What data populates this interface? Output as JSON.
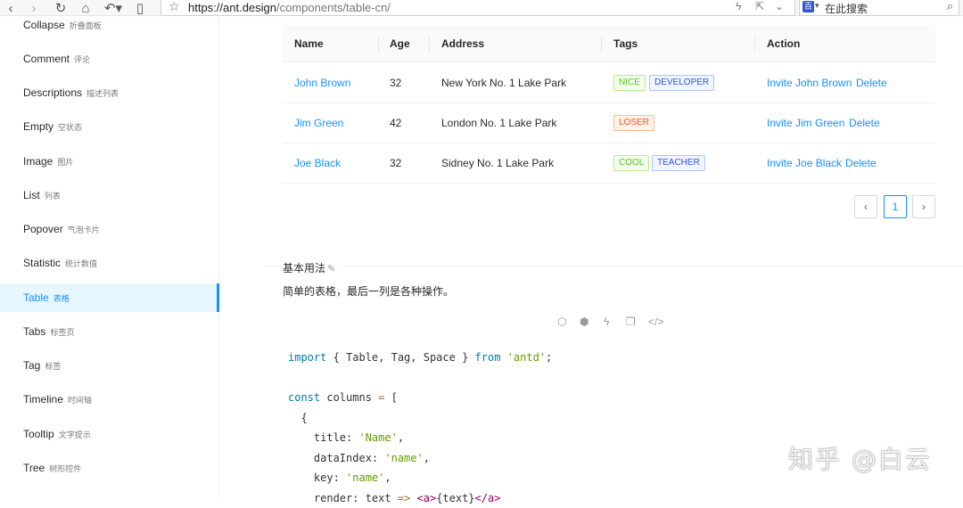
{
  "browser": {
    "url_host": "https://ant.design",
    "url_path": "/components/table-cn/",
    "search_placeholder": "在此搜索",
    "search_engine_label": "百"
  },
  "sidebar": {
    "items": [
      {
        "label": "Collapse",
        "cn": "折叠面板"
      },
      {
        "label": "Comment",
        "cn": "评论"
      },
      {
        "label": "Descriptions",
        "cn": "描述列表"
      },
      {
        "label": "Empty",
        "cn": "空状态"
      },
      {
        "label": "Image",
        "cn": "图片"
      },
      {
        "label": "List",
        "cn": "列表"
      },
      {
        "label": "Popover",
        "cn": "气泡卡片"
      },
      {
        "label": "Statistic",
        "cn": "统计数值"
      },
      {
        "label": "Table",
        "cn": "表格"
      },
      {
        "label": "Tabs",
        "cn": "标签页"
      },
      {
        "label": "Tag",
        "cn": "标签"
      },
      {
        "label": "Timeline",
        "cn": "时间轴"
      },
      {
        "label": "Tooltip",
        "cn": "文字提示"
      },
      {
        "label": "Tree",
        "cn": "树形控件"
      }
    ],
    "active": "Table"
  },
  "table": {
    "columns": [
      "Name",
      "Age",
      "Address",
      "Tags",
      "Action"
    ],
    "rows": [
      {
        "name": "John Brown",
        "age": "32",
        "address": "New York No. 1 Lake Park",
        "tags": [
          "NICE",
          "DEVELOPER"
        ],
        "invite": "Invite John Brown",
        "delete": "Delete"
      },
      {
        "name": "Jim Green",
        "age": "42",
        "address": "London No. 1 Lake Park",
        "tags": [
          "LOSER"
        ],
        "invite": "Invite Jim Green",
        "delete": "Delete"
      },
      {
        "name": "Joe Black",
        "age": "32",
        "address": "Sidney No. 1 Lake Park",
        "tags": [
          "COOL",
          "TEACHER"
        ],
        "invite": "Invite Joe Black",
        "delete": "Delete"
      }
    ],
    "tag_colors": {
      "green": "#52c41a",
      "geekblue": "#2f54eb",
      "volcano": "#fa541c"
    }
  },
  "pagination": {
    "prev": "‹",
    "page": "1",
    "next": "›"
  },
  "demo": {
    "title": "基本用法",
    "description": "简单的表格，最后一列是各种操作。",
    "action_icons": [
      "codesandbox-icon",
      "codepen-icon",
      "riddle-icon",
      "copy-icon",
      "expand-code-icon"
    ]
  },
  "code": {
    "l1_import": "import",
    "l1_names": " { Table, Tag, Space } ",
    "l1_from": "from",
    "l1_module": "'antd'",
    "l1_end": ";",
    "l3_const": "const",
    "l3_name": " columns ",
    "l3_eq": "=",
    "l3_bracket": " [",
    "l4": "  {",
    "l5_key": "    title: ",
    "l5_val": "'Name'",
    "l5_end": ",",
    "l6_key": "    dataIndex: ",
    "l6_val": "'name'",
    "l6_end": ",",
    "l7_key": "    key: ",
    "l7_val": "'name'",
    "l7_end": ",",
    "l8_key": "    render: text ",
    "l8_arrow": "=>",
    "l8_open": " <a>",
    "l8_text": "{text}",
    "l8_close": "</a>"
  },
  "watermark": "知乎 @白云",
  "accent_color": "#1890ff"
}
